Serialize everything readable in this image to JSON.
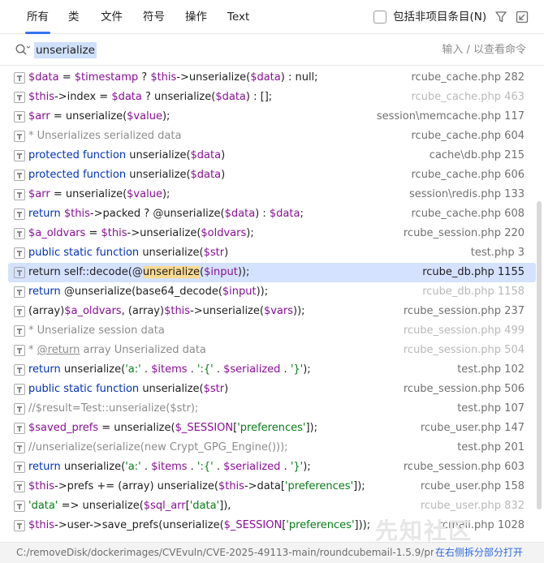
{
  "tabs": [
    "所有",
    "类",
    "文件",
    "符号",
    "操作",
    "Text"
  ],
  "active_tab": 0,
  "include_non_project_label": "包括非项目条目(N)",
  "include_non_project_checked": false,
  "search": {
    "query": "unserialize",
    "hint": "输入 / 以查看命令"
  },
  "icons": {
    "filter": "filter-icon",
    "pin": "open-in-window-icon",
    "search": "search-icon",
    "row": "text-occurrence-icon"
  },
  "results": [
    {
      "code": [
        [
          "v",
          "$data"
        ],
        [
          "t",
          " = "
        ],
        [
          "v",
          "$timestamp"
        ],
        [
          "t",
          " ? "
        ],
        [
          "v",
          "$this"
        ],
        [
          "t",
          "->unserialize("
        ],
        [
          "v",
          "$data"
        ],
        [
          "t",
          ") : null;"
        ]
      ],
      "file": "rcube_cache.php 282",
      "style": ""
    },
    {
      "code": [
        [
          "v",
          "$this"
        ],
        [
          "t",
          "->index = "
        ],
        [
          "v",
          "$data"
        ],
        [
          "t",
          " ? unserialize("
        ],
        [
          "v",
          "$data"
        ],
        [
          "t",
          ") : [];"
        ]
      ],
      "file": "rcube_cache.php 463",
      "style": "dim"
    },
    {
      "code": [
        [
          "v",
          "$arr"
        ],
        [
          "t",
          " = unserialize("
        ],
        [
          "v",
          "$value"
        ],
        [
          "t",
          ");"
        ]
      ],
      "file": "session\\memcache.php 117",
      "style": ""
    },
    {
      "code": [
        [
          "c",
          "* Unserializes serialized data"
        ]
      ],
      "file": "rcube_cache.php 604",
      "style": ""
    },
    {
      "code": [
        [
          "k",
          "protected function "
        ],
        [
          "t",
          "unserialize("
        ],
        [
          "v",
          "$data"
        ],
        [
          "t",
          ")"
        ]
      ],
      "file": "cache\\db.php 215",
      "style": ""
    },
    {
      "code": [
        [
          "k",
          "protected function "
        ],
        [
          "t",
          "unserialize("
        ],
        [
          "v",
          "$data"
        ],
        [
          "t",
          ")"
        ]
      ],
      "file": "rcube_cache.php 606",
      "style": ""
    },
    {
      "code": [
        [
          "v",
          "$arr"
        ],
        [
          "t",
          " = unserialize("
        ],
        [
          "v",
          "$value"
        ],
        [
          "t",
          ");"
        ]
      ],
      "file": "session\\redis.php 133",
      "style": ""
    },
    {
      "code": [
        [
          "k",
          "return "
        ],
        [
          "v",
          "$this"
        ],
        [
          "t",
          "->packed ? @unserialize("
        ],
        [
          "v",
          "$data"
        ],
        [
          "t",
          ") : "
        ],
        [
          "v",
          "$data"
        ],
        [
          "t",
          ";"
        ]
      ],
      "file": "rcube_cache.php 608",
      "style": ""
    },
    {
      "code": [
        [
          "v",
          "$a_oldvars"
        ],
        [
          "t",
          " = "
        ],
        [
          "v",
          "$this"
        ],
        [
          "t",
          "->unserialize("
        ],
        [
          "v",
          "$oldvars"
        ],
        [
          "t",
          ");"
        ]
      ],
      "file": "rcube_session.php 220",
      "style": ""
    },
    {
      "code": [
        [
          "k",
          "public static function "
        ],
        [
          "t",
          "unserialize("
        ],
        [
          "v",
          "$str"
        ],
        [
          "t",
          ")"
        ]
      ],
      "file": "test.php 3",
      "style": ""
    },
    {
      "code": [
        [
          "t",
          "return self::decode(@"
        ],
        [
          "h",
          "unserialize"
        ],
        [
          "t",
          "("
        ],
        [
          "v",
          "$input"
        ],
        [
          "t",
          "));"
        ]
      ],
      "file": "rcube_db.php 1155",
      "style": "sel"
    },
    {
      "code": [
        [
          "k",
          "return "
        ],
        [
          "t",
          "@unserialize(base64_decode("
        ],
        [
          "v",
          "$input"
        ],
        [
          "t",
          "));"
        ]
      ],
      "file": "rcube_db.php 1158",
      "style": "dim"
    },
    {
      "code": [
        [
          "t",
          "(array)"
        ],
        [
          "v",
          "$a_oldvars"
        ],
        [
          "t",
          ", (array)"
        ],
        [
          "v",
          "$this"
        ],
        [
          "t",
          "->unserialize("
        ],
        [
          "v",
          "$vars"
        ],
        [
          "t",
          "));"
        ]
      ],
      "file": "rcube_session.php 237",
      "style": ""
    },
    {
      "code": [
        [
          "c",
          "* Unserialize session data"
        ]
      ],
      "file": "rcube_session.php 499",
      "style": "dim"
    },
    {
      "code": [
        [
          "c",
          "* "
        ],
        [
          "cu",
          "@return"
        ],
        [
          "c",
          " array Unserialized data"
        ]
      ],
      "file": "rcube_session.php 504",
      "style": "dim"
    },
    {
      "code": [
        [
          "k",
          "return "
        ],
        [
          "t",
          "unserialize("
        ],
        [
          "s",
          "'a:'"
        ],
        [
          "t",
          " . "
        ],
        [
          "v",
          "$items"
        ],
        [
          "t",
          " . "
        ],
        [
          "s",
          "':{'"
        ],
        [
          "t",
          " . "
        ],
        [
          "v",
          "$serialized"
        ],
        [
          "t",
          " . "
        ],
        [
          "s",
          "'}'"
        ],
        [
          "t",
          ");"
        ]
      ],
      "file": "test.php 102",
      "style": ""
    },
    {
      "code": [
        [
          "k",
          "public static function "
        ],
        [
          "t",
          "unserialize("
        ],
        [
          "v",
          "$str"
        ],
        [
          "t",
          ")"
        ]
      ],
      "file": "rcube_session.php 506",
      "style": ""
    },
    {
      "code": [
        [
          "c",
          "//$result=Test::unserialize($str);"
        ]
      ],
      "file": "test.php 107",
      "style": ""
    },
    {
      "code": [
        [
          "v",
          "$saved_prefs"
        ],
        [
          "t",
          " = unserialize("
        ],
        [
          "v",
          "$_SESSION"
        ],
        [
          "t",
          "["
        ],
        [
          "s",
          "'preferences'"
        ],
        [
          "t",
          "]);"
        ]
      ],
      "file": "rcube_user.php 147",
      "style": ""
    },
    {
      "code": [
        [
          "c",
          "//unserialize(serialize(new Crypt_GPG_Engine()));"
        ]
      ],
      "file": "test.php 201",
      "style": ""
    },
    {
      "code": [
        [
          "k",
          "return "
        ],
        [
          "t",
          "unserialize("
        ],
        [
          "s",
          "'a:'"
        ],
        [
          "t",
          " . "
        ],
        [
          "v",
          "$items"
        ],
        [
          "t",
          " . "
        ],
        [
          "s",
          "':{'"
        ],
        [
          "t",
          " . "
        ],
        [
          "v",
          "$serialized"
        ],
        [
          "t",
          " . "
        ],
        [
          "s",
          "'}'"
        ],
        [
          "t",
          ");"
        ]
      ],
      "file": "rcube_session.php 603",
      "style": ""
    },
    {
      "code": [
        [
          "v",
          "$this"
        ],
        [
          "t",
          "->prefs += (array) unserialize("
        ],
        [
          "v",
          "$this"
        ],
        [
          "t",
          "->data["
        ],
        [
          "s",
          "'preferences'"
        ],
        [
          "t",
          "]);"
        ]
      ],
      "file": "rcube_user.php 158",
      "style": ""
    },
    {
      "code": [
        [
          "s",
          "'data'"
        ],
        [
          "t",
          " => unserialize("
        ],
        [
          "v",
          "$sql_arr"
        ],
        [
          "t",
          "["
        ],
        [
          "s",
          "'data'"
        ],
        [
          "t",
          "]),"
        ]
      ],
      "file": "rcube_user.php 832",
      "style": "dim"
    },
    {
      "code": [
        [
          "v",
          "$this"
        ],
        [
          "t",
          "->user->save_prefs(unserialize("
        ],
        [
          "v",
          "$_SESSION"
        ],
        [
          "t",
          "["
        ],
        [
          "s",
          "'preferences'"
        ],
        [
          "t",
          "]));"
        ]
      ],
      "file": "rcmail.php 1028",
      "style": ""
    }
  ],
  "status": {
    "path": "C:/removeDisk/dockerimages/CVEvuln/CVE-2025-49113-main/roundcubemail-1.5.9/pr...",
    "link": "在右侧拆分部分打开"
  },
  "watermark": "先知社区",
  "colors": {
    "accent": "#3574f0",
    "selected_row": "#d4e2ff",
    "match_highlight": "#fbd990",
    "keyword": "#0033b3",
    "variable": "#871094",
    "string": "#067d17",
    "comment": "#8c8c8c"
  }
}
